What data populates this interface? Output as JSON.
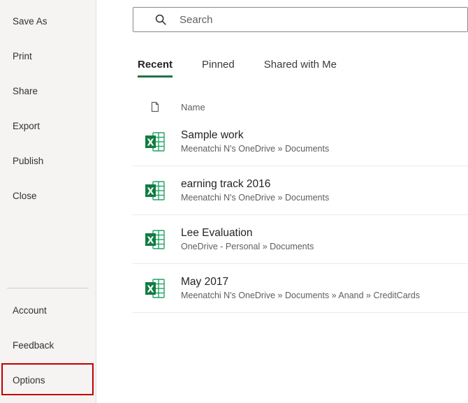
{
  "sidebar": {
    "items": [
      {
        "label": "Save As"
      },
      {
        "label": "Print"
      },
      {
        "label": "Share"
      },
      {
        "label": "Export"
      },
      {
        "label": "Publish"
      },
      {
        "label": "Close"
      }
    ],
    "footer_items": [
      {
        "label": "Account"
      },
      {
        "label": "Feedback"
      },
      {
        "label": "Options",
        "highlighted": true
      }
    ]
  },
  "search": {
    "placeholder": "Search"
  },
  "tabs": [
    {
      "label": "Recent",
      "active": true
    },
    {
      "label": "Pinned",
      "active": false
    },
    {
      "label": "Shared with Me",
      "active": false
    }
  ],
  "list": {
    "header": {
      "name_label": "Name"
    },
    "files": [
      {
        "title": "Sample work",
        "location": "Meenatchi N's OneDrive » Documents"
      },
      {
        "title": "earning track 2016",
        "location": "Meenatchi N's OneDrive » Documents"
      },
      {
        "title": "Lee Evaluation",
        "location": "OneDrive - Personal » Documents"
      },
      {
        "title": "May 2017",
        "location": "Meenatchi N's OneDrive » Documents » Anand » CreditCards"
      }
    ]
  },
  "colors": {
    "excel_green": "#107C41",
    "excel_green_light": "#21A366",
    "tab_underline": "#217346",
    "annotation_red": "#C00000"
  }
}
